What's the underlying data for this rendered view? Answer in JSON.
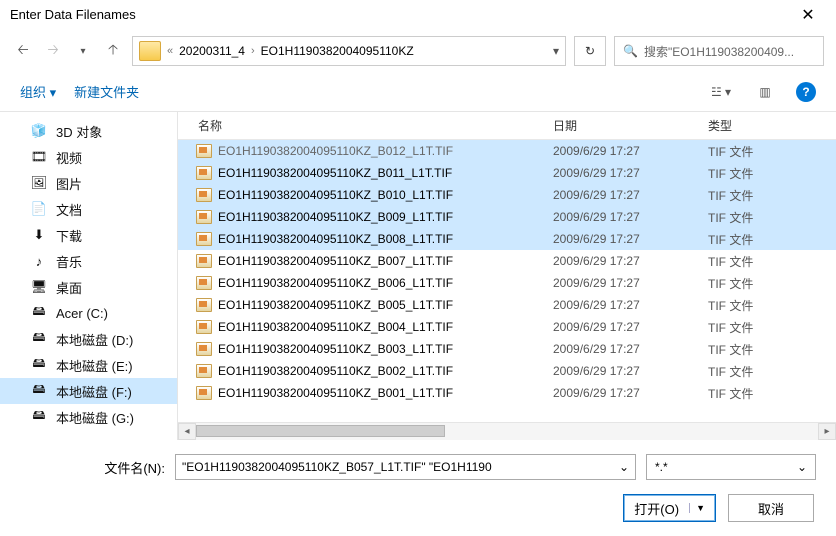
{
  "title": "Enter Data Filenames",
  "breadcrumb": {
    "prefix": "«",
    "seg1": "20200311_4",
    "seg2": "EO1H1190382004095110KZ"
  },
  "search": {
    "placeholder": "搜索\"EO1H119038200409..."
  },
  "toolbar": {
    "organize": "组织",
    "newfolder": "新建文件夹"
  },
  "columns": {
    "name": "名称",
    "date": "日期",
    "type": "类型"
  },
  "sidebar": [
    {
      "label": "3D 对象",
      "icon": "🧊"
    },
    {
      "label": "视频",
      "icon": "🎞"
    },
    {
      "label": "图片",
      "icon": "🖼"
    },
    {
      "label": "文档",
      "icon": "📄"
    },
    {
      "label": "下载",
      "icon": "⬇"
    },
    {
      "label": "音乐",
      "icon": "♪"
    },
    {
      "label": "桌面",
      "icon": "🖥"
    },
    {
      "label": "Acer (C:)",
      "icon": "🖴"
    },
    {
      "label": "本地磁盘 (D:)",
      "icon": "🖴"
    },
    {
      "label": "本地磁盘 (E:)",
      "icon": "🖴"
    },
    {
      "label": "本地磁盘 (F:)",
      "icon": "🖴",
      "selected": true
    },
    {
      "label": "本地磁盘 (G:)",
      "icon": "🖴"
    }
  ],
  "files": [
    {
      "name": "EO1H1190382004095110KZ_B012_L1T.TIF",
      "date": "2009/6/29 17:27",
      "type": "TIF 文件",
      "selected": true,
      "cut": true
    },
    {
      "name": "EO1H1190382004095110KZ_B011_L1T.TIF",
      "date": "2009/6/29 17:27",
      "type": "TIF 文件",
      "selected": true
    },
    {
      "name": "EO1H1190382004095110KZ_B010_L1T.TIF",
      "date": "2009/6/29 17:27",
      "type": "TIF 文件",
      "selected": true
    },
    {
      "name": "EO1H1190382004095110KZ_B009_L1T.TIF",
      "date": "2009/6/29 17:27",
      "type": "TIF 文件",
      "selected": true
    },
    {
      "name": "EO1H1190382004095110KZ_B008_L1T.TIF",
      "date": "2009/6/29 17:27",
      "type": "TIF 文件",
      "selected": true
    },
    {
      "name": "EO1H1190382004095110KZ_B007_L1T.TIF",
      "date": "2009/6/29 17:27",
      "type": "TIF 文件",
      "selected": false
    },
    {
      "name": "EO1H1190382004095110KZ_B006_L1T.TIF",
      "date": "2009/6/29 17:27",
      "type": "TIF 文件",
      "selected": false
    },
    {
      "name": "EO1H1190382004095110KZ_B005_L1T.TIF",
      "date": "2009/6/29 17:27",
      "type": "TIF 文件",
      "selected": false
    },
    {
      "name": "EO1H1190382004095110KZ_B004_L1T.TIF",
      "date": "2009/6/29 17:27",
      "type": "TIF 文件",
      "selected": false
    },
    {
      "name": "EO1H1190382004095110KZ_B003_L1T.TIF",
      "date": "2009/6/29 17:27",
      "type": "TIF 文件",
      "selected": false
    },
    {
      "name": "EO1H1190382004095110KZ_B002_L1T.TIF",
      "date": "2009/6/29 17:27",
      "type": "TIF 文件",
      "selected": false
    },
    {
      "name": "EO1H1190382004095110KZ_B001_L1T.TIF",
      "date": "2009/6/29 17:27",
      "type": "TIF 文件",
      "selected": false
    }
  ],
  "footer": {
    "filename_label": "文件名(N):",
    "filename_value": "\"EO1H1190382004095110KZ_B057_L1T.TIF\" \"EO1H1190",
    "filter": "*.*",
    "open": "打开(O)",
    "cancel": "取消"
  }
}
